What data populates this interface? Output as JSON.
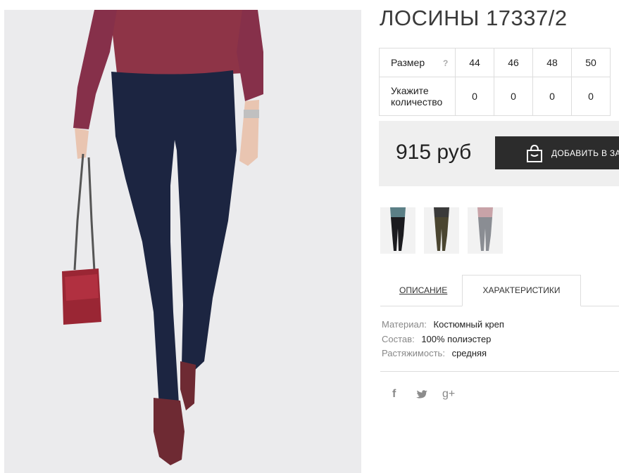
{
  "product": {
    "title": "ЛОСИНЫ 17337/2",
    "image_alt": "model-wearing-navy-leggings"
  },
  "size_table": {
    "size_label": "Размер",
    "help_icon": "?",
    "sizes": [
      "44",
      "46",
      "48",
      "50"
    ],
    "quantity_label_line1": "Укажите",
    "quantity_label_line2": "количество",
    "quantities": [
      "0",
      "0",
      "0",
      "0"
    ]
  },
  "purchase": {
    "price": "915 руб",
    "cart_button_label": "ДОБАВИТЬ В ЗА",
    "cart_icon": "shopping-bag-icon"
  },
  "thumbnails": [
    {
      "name": "black",
      "top_color": "#5b7f86",
      "pants_color": "#1b1b1f"
    },
    {
      "name": "olive",
      "top_color": "#3a3a3a",
      "pants_color": "#4a4530"
    },
    {
      "name": "grey",
      "top_color": "#c8a3a8",
      "pants_color": "#8a8d93"
    }
  ],
  "tabs": {
    "description_label": "ОПИСАНИЕ",
    "characteristics_label": "ХАРАКТЕРИСТИКИ",
    "active": "characteristics"
  },
  "properties": [
    {
      "key": "Материал:",
      "value": "Костюмный креп"
    },
    {
      "key": "Состав:",
      "value": "100% полиэстер"
    },
    {
      "key": "Растяжимость:",
      "value": "средняя"
    }
  ],
  "social": {
    "facebook_glyph": "f",
    "twitter_icon": "twitter-icon",
    "gplus_glyph": "g+"
  },
  "colors": {
    "sweater": "#8e3447",
    "pants": "#1c2541",
    "bag": "#9a2634",
    "button_bg": "#2c2c2c",
    "price_box_bg": "#efefef"
  }
}
